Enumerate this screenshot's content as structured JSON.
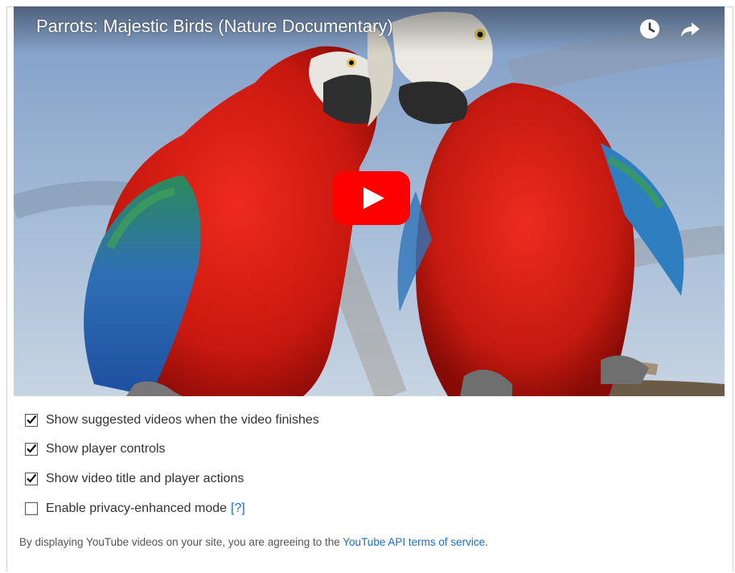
{
  "player": {
    "video_title": "Parrots: Majestic Birds (Nature Documentary)",
    "icons": {
      "watch_later": "clock-icon",
      "share": "share-arrow-icon",
      "play": "play-icon"
    },
    "colors": {
      "play_button": "#ff0000",
      "title_text": "#ffffff"
    }
  },
  "options": [
    {
      "label": "Show suggested videos when the video finishes",
      "checked": true
    },
    {
      "label": "Show player controls",
      "checked": true
    },
    {
      "label": "Show video title and player actions",
      "checked": true
    },
    {
      "label": "Enable privacy-enhanced mode",
      "checked": false,
      "help_link": "[?]"
    }
  ],
  "disclaimer": {
    "text": "By displaying YouTube videos on your site, you are agreeing to the ",
    "link": "YouTube API terms of service",
    "suffix": "."
  },
  "colors": {
    "link": "#1a6fc4",
    "text": "#333333"
  }
}
